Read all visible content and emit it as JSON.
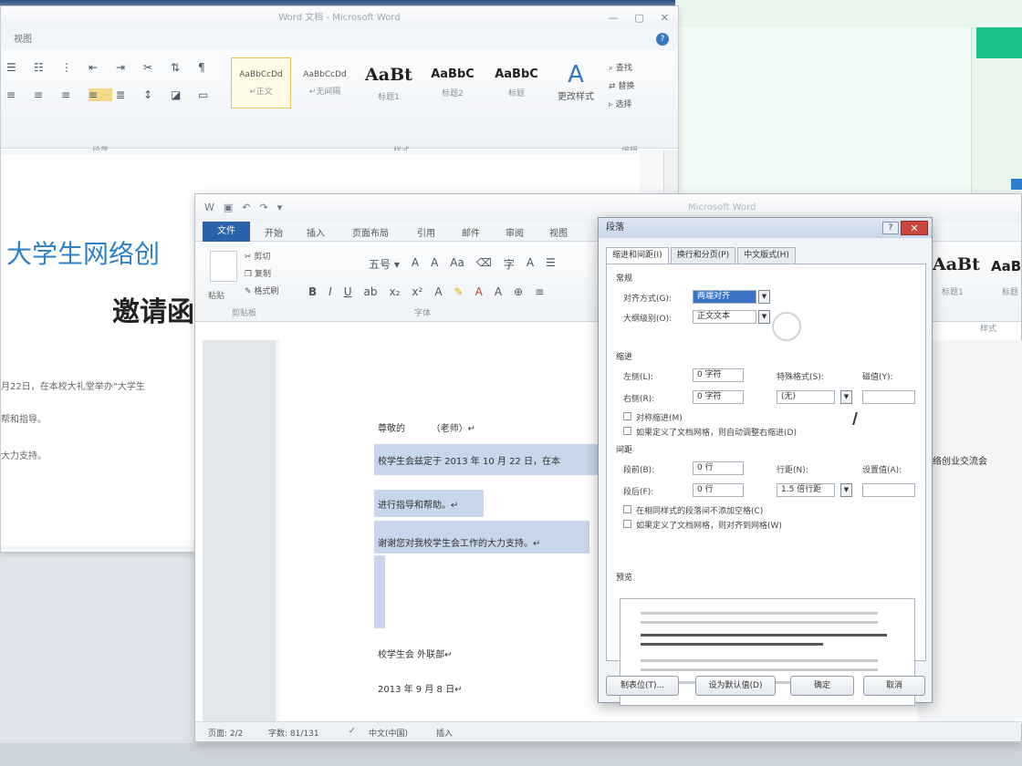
{
  "back_window": {
    "title": "Word 文档 - Microsoft Word",
    "ribbon_tab": "视图",
    "styles": [
      {
        "preview": "AaBbCcDd",
        "name": "↵正文",
        "selected": true
      },
      {
        "preview": "AaBbCcDd",
        "name": "↵无间隔"
      },
      {
        "preview": "AaBt",
        "name": "标题1"
      },
      {
        "preview": "AaBbC",
        "name": "标题2"
      },
      {
        "preview": "AaBbC",
        "name": "标题"
      }
    ],
    "change_styles": "更改样式",
    "edit_items": [
      "查找",
      "替换",
      "选择"
    ],
    "group_labels": {
      "para": "段落",
      "style": "样式",
      "edit": "编辑"
    },
    "doc_title": "大学生网络创",
    "doc_invite": "邀请函",
    "body_lines": [
      "月22日，在本校大礼堂举办“大学生",
      "帮和指导。",
      "大力支持。"
    ]
  },
  "front_window": {
    "window_title": "Microsoft Word",
    "tabs": [
      "文件",
      "开始",
      "插入",
      "页面布局",
      "引用",
      "邮件",
      "审阅",
      "视图"
    ],
    "clipboard": {
      "paste": "粘贴",
      "items": [
        "剪切",
        "复制",
        "格式刷"
      ],
      "label": "剪贴板"
    },
    "font_label": "字体",
    "style_previews": [
      "AaBt",
      "AaB"
    ],
    "style_names": [
      "标题1",
      "标题"
    ],
    "right_group": "样式",
    "doc": {
      "salutation": "尊敬的",
      "teacher": "（老师）↵",
      "line1": "校学生会兹定于 2013 年 10 月 22 日，在本",
      "line2": "进行指导和帮助。↵",
      "line3": "谢谢您对我校学生会工作的大力支持。↵",
      "right_text": "络创业交流会",
      "signature": "校学生会 外联部↵",
      "date": "2013 年 9 月 8 日↵"
    },
    "status": {
      "page": "页面: 2/2",
      "words": "字数: 81/131",
      "lang": "中文(中国)",
      "mode": "插入"
    }
  },
  "dialog": {
    "title": "段落",
    "tabs": [
      "缩进和间距(I)",
      "换行和分页(P)",
      "中文版式(H)"
    ],
    "general_section": "常规",
    "alignment_label": "对齐方式(G):",
    "alignment_value": "两端对齐",
    "outline_label": "大纲级别(O):",
    "outline_value": "正文文本",
    "indent_section": "缩进",
    "left_label": "左侧(L):",
    "left_value": "0 字符",
    "right_label": "右侧(R):",
    "right_value": "0 字符",
    "special_label": "特殊格式(S):",
    "special_value": "(无)",
    "measure_label": "磁值(Y):",
    "mirror_label": "对称缩进(M)",
    "grid_indent_label": "如果定义了文档网格，则自动调整右缩进(D)",
    "spacing_section": "间距",
    "before_label": "段前(B):",
    "before_value": "0 行",
    "after_label": "段后(F):",
    "after_value": "0 行",
    "line_label": "行距(N):",
    "line_value": "1.5 倍行距",
    "setval_label": "设置值(A):",
    "nospace_label": "在相同样式的段落间不添加空格(C)",
    "snap_label": "如果定义了文档网格，则对齐到网格(W)",
    "preview_section": "预览",
    "buttons": [
      "制表位(T)...",
      "设为默认值(D)",
      "确定",
      "取消"
    ]
  }
}
